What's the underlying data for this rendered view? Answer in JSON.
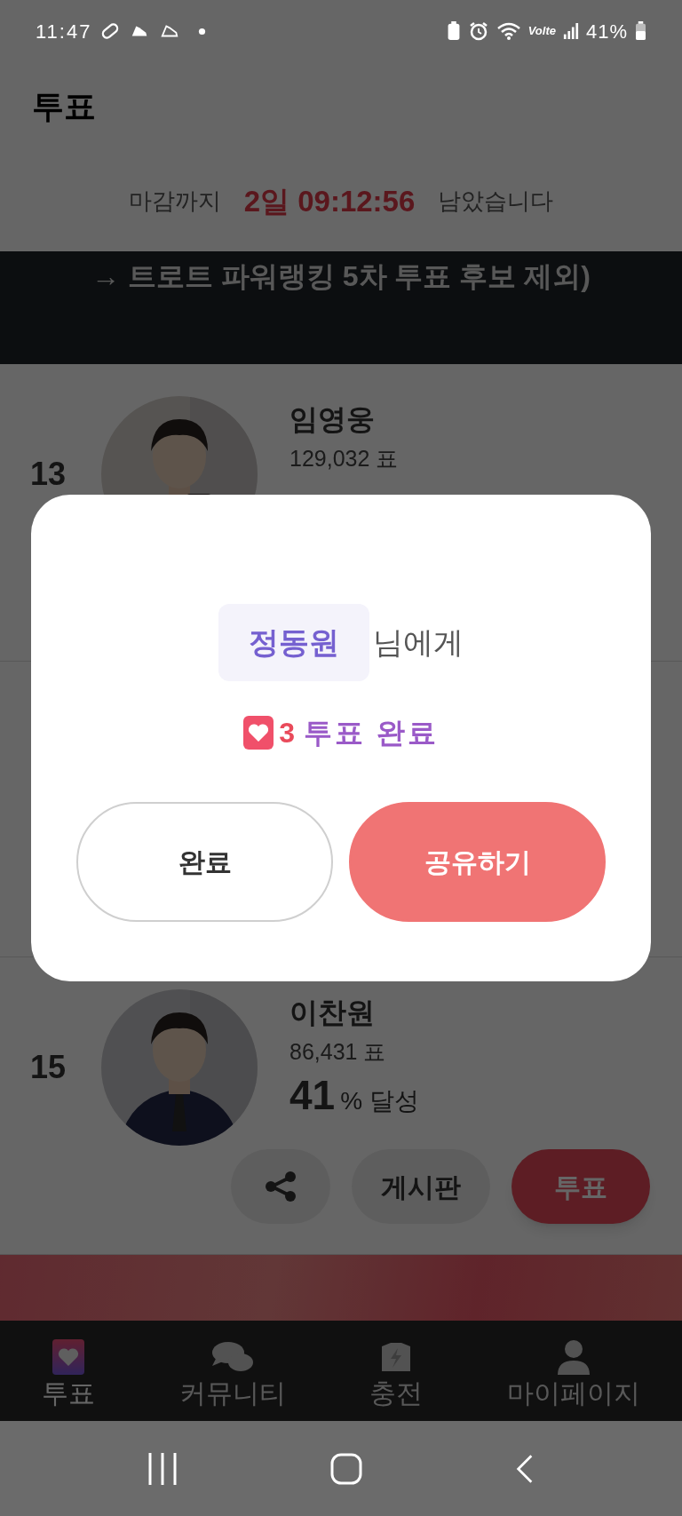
{
  "status_bar": {
    "time": "11:47",
    "network": "Volte",
    "battery": "41%"
  },
  "header": {
    "title": "투표"
  },
  "countdown": {
    "prefix": "마감까지",
    "remaining": "2일 09:12:56",
    "suffix": "남았습니다"
  },
  "notice_banner": {
    "text": "→ 트로트 파워랭킹 5차 투표 후보 제외)"
  },
  "candidates": [
    {
      "rank": "13",
      "name": "임영웅",
      "votes": "129,032 표"
    },
    {
      "rank": "15",
      "name": "이찬원",
      "votes": "86,431 표",
      "percent": "41",
      "percent_suffix": "% 달성",
      "board_button": "게시판",
      "vote_button": "투표"
    }
  ],
  "dialog": {
    "recipient": "정동원",
    "recipient_suffix": "님에게",
    "vote_count": "3",
    "vote_result": "투표 완료",
    "buttons": [
      {
        "label": "완료",
        "kind": "secondary"
      },
      {
        "label": "공유하기",
        "kind": "primary"
      }
    ]
  },
  "bottom_nav": [
    {
      "label": "투표",
      "selected": true
    },
    {
      "label": "커뮤니티",
      "selected": false
    },
    {
      "label": "충전",
      "selected": false
    },
    {
      "label": "마이페이지",
      "selected": false
    }
  ]
}
